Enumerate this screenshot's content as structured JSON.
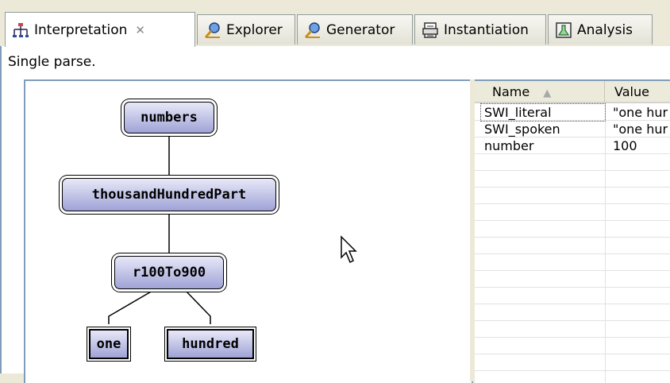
{
  "tabs": [
    {
      "label": "Interpretation",
      "icon": "tree-icon",
      "active": true,
      "closable": true
    },
    {
      "label": "Explorer",
      "icon": "magnifier-icon",
      "active": false
    },
    {
      "label": "Generator",
      "icon": "magnifier-icon",
      "active": false
    },
    {
      "label": "Instantiation",
      "icon": "printer-icon",
      "active": false
    },
    {
      "label": "Analysis",
      "icon": "analysis-icon",
      "active": false
    }
  ],
  "status": "Single parse.",
  "tree": {
    "root": "numbers",
    "child": "thousandHundredPart",
    "grandchild": "r100To900",
    "leaves": [
      "one",
      "hundred"
    ]
  },
  "properties": {
    "columns": [
      "Name",
      "Value"
    ],
    "rows": [
      {
        "name": "SWI_literal",
        "value": "\"one hur"
      },
      {
        "name": "SWI_spoken",
        "value": "\"one hur"
      },
      {
        "name": "number",
        "value": "100"
      }
    ]
  },
  "colors": {
    "node_fill_top": "#e8e8f8",
    "node_fill_bottom": "#9fa3d6",
    "panel_border": "#7f9db9",
    "window_bg": "#ece9d8"
  }
}
